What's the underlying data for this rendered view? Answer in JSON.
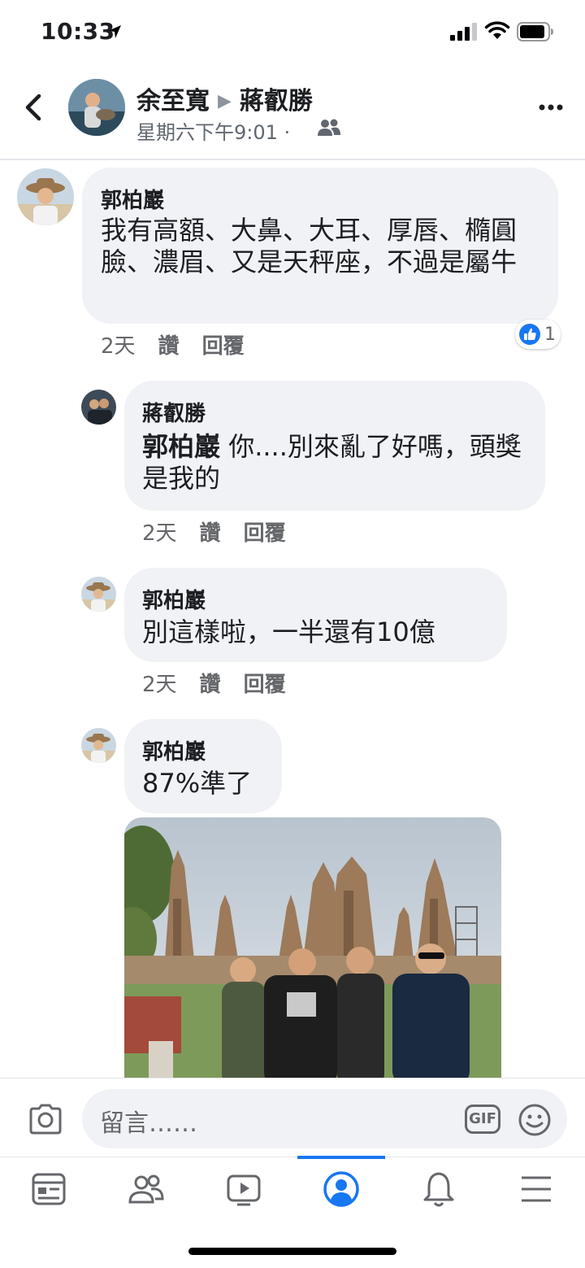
{
  "status_bar": {
    "time": "10:33"
  },
  "header": {
    "author": "余至寬",
    "target": "蔣叡勝",
    "timestamp": "星期六下午9:01",
    "separator": "·",
    "audience_icon": "friends-icon"
  },
  "comments": [
    {
      "author": "郭柏巖",
      "text": "我有高額、大鼻、大耳、厚唇、橢圓臉、濃眉、又是天秤座，不過是屬牛",
      "time": "2天",
      "like": "讚",
      "reply": "回覆",
      "reaction_count": "1"
    },
    {
      "author": "蔣叡勝",
      "mention": "郭柏巖",
      "text": " 你....別來亂了好嗎，頭獎是我的",
      "time": "2天",
      "like": "讚",
      "reply": "回覆"
    },
    {
      "author": "郭柏巖",
      "text": "別這樣啦，一半還有10億",
      "time": "2天",
      "like": "讚",
      "reply": "回覆"
    },
    {
      "author": "郭柏巖",
      "text": "87%準了"
    }
  ],
  "composer": {
    "placeholder": "留言……",
    "gif_label": "GIF"
  },
  "tab_bar": {
    "tabs": [
      "news-feed-icon",
      "friends-icon",
      "watch-icon",
      "profile-icon",
      "notifications-bell-icon",
      "menu-icon"
    ],
    "active": "profile-icon"
  },
  "colors": {
    "accent": "#1877f2",
    "bubble": "#f0f2f5",
    "meta": "#65676b"
  }
}
